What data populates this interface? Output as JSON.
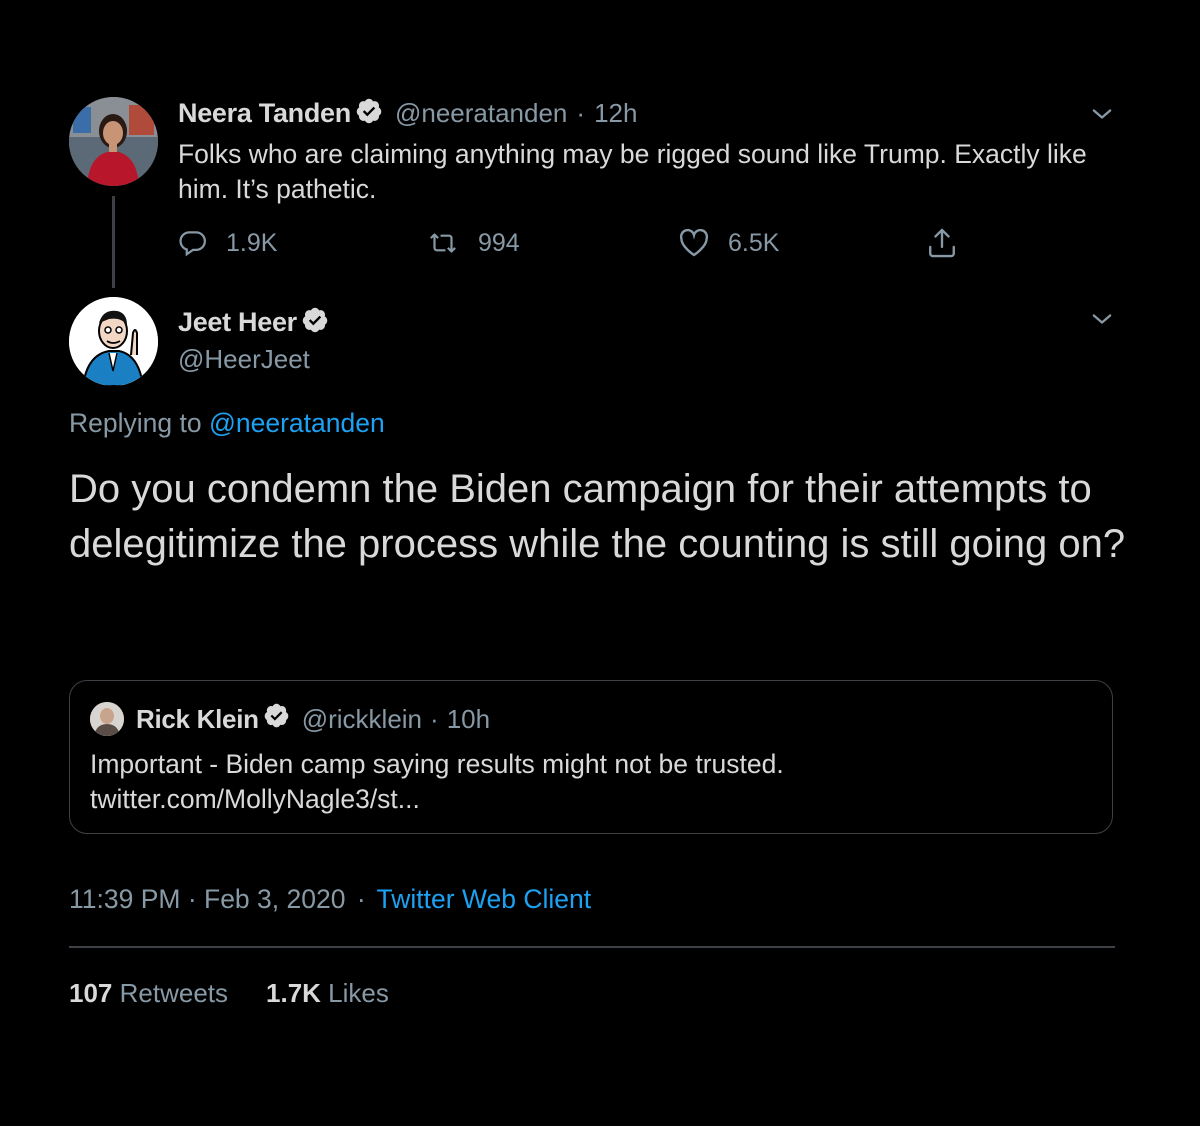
{
  "parent_tweet": {
    "author_name": "Neera Tanden",
    "handle": "@neeratanden",
    "separator": "·",
    "time_ago": "12h",
    "text": "Folks who are claiming anything may be rigged sound like Trump. Exactly like him. It’s pathetic.",
    "replies": "1.9K",
    "retweets": "994",
    "likes": "6.5K",
    "icons": [
      "reply-icon",
      "retweet-icon",
      "like-icon",
      "share-icon",
      "chevron-down-icon",
      "verified-icon"
    ]
  },
  "main_tweet": {
    "author_name": "Jeet Heer",
    "handle": "@HeerJeet",
    "replying_label": "Replying to",
    "replying_handle": "@neeratanden",
    "text": "Do you condemn the Biden campaign for their attempts to delegitimize the process while the counting is still going on?",
    "timestamp": "11:39 PM · Feb 3, 2020",
    "meta_separator": "·",
    "client": "Twitter Web Client",
    "retweet_count": "107",
    "retweet_label": "Retweets",
    "like_count": "1.7K",
    "like_label": "Likes"
  },
  "quoted_tweet": {
    "author_name": "Rick Klein",
    "handle": "@rickklein",
    "separator": "·",
    "time_ago": "10h",
    "line1": "Important - Biden camp saying results might not be trusted.",
    "line2": "twitter.com/MollyNagle3/st..."
  },
  "colors": {
    "background": "#000000",
    "text": "#d9d9d9",
    "muted": "#8899a6",
    "link": "#1da1f2",
    "border": "#3d4145"
  }
}
